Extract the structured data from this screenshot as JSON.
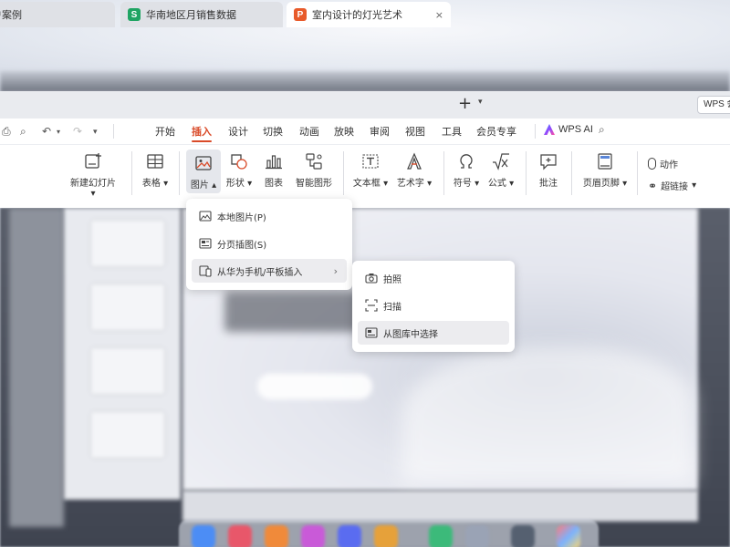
{
  "tabs": [
    {
      "label": "客户案例",
      "icon_letter": "",
      "icon_color": ""
    },
    {
      "label": "华南地区月销售数据",
      "icon_letter": "S",
      "icon_color": "#1fa463"
    },
    {
      "label": "室内设计的灯光艺术",
      "icon_letter": "P",
      "icon_color": "#e85a2a"
    }
  ],
  "tab_close": "×",
  "new_tab": "+",
  "wps_account": "WPS 会",
  "menu": [
    "开始",
    "插入",
    "设计",
    "切换",
    "动画",
    "放映",
    "审阅",
    "视图",
    "工具",
    "会员专享"
  ],
  "active_menu": "插入",
  "wps_ai": "WPS AI",
  "ribbon": {
    "new_slide": "新建幻灯片",
    "table": "表格",
    "picture": "图片",
    "shape": "形状",
    "chart": "图表",
    "smart_shape": "智能图形",
    "textbox": "文本框",
    "wordart": "艺术字",
    "symbol": "符号",
    "formula": "公式",
    "comment": "批注",
    "header_footer": "页眉页脚",
    "action": "动作",
    "hyperlink": "超链接"
  },
  "picture_menu": {
    "local": "本地图片(P)",
    "paged": "分页插图(S)",
    "from_device": "从华为手机/平板插入"
  },
  "device_submenu": {
    "photo": "拍照",
    "scan": "扫描",
    "gallery": "从图库中选择"
  },
  "colors": {
    "accent": "#d94a28",
    "ai_blue": "#3a7bff"
  }
}
